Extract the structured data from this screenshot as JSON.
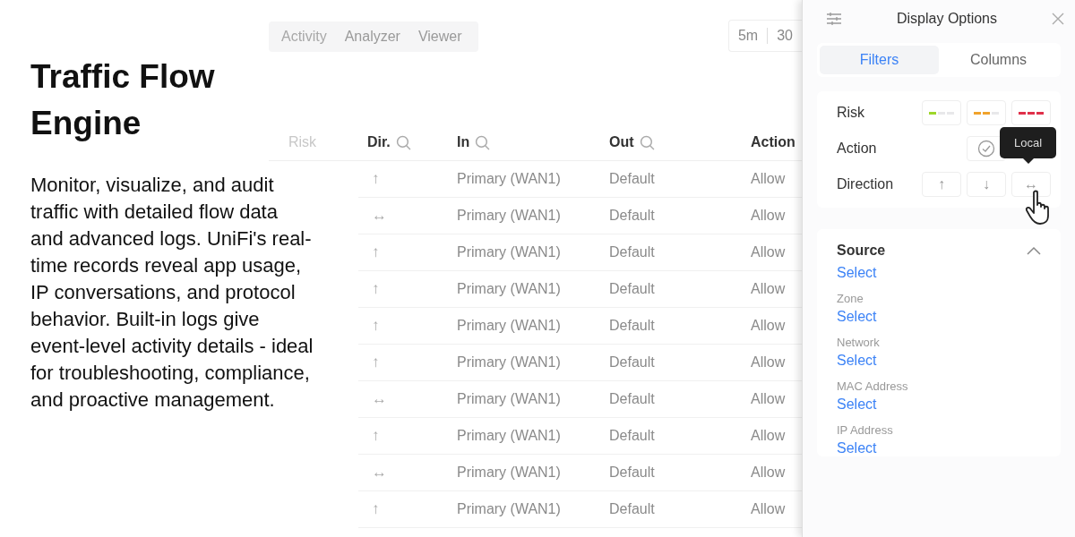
{
  "headline": "Traffic Flow Engine",
  "description": "Monitor, visualize, and audit traffic with detailed flow data and advanced logs. UniFi's real-time records reveal app usage, IP conversations, and protocol behavior. Built-in logs give event-level activity details - ideal for troubleshooting, compliance, and proactive management.",
  "toolbar": {
    "view_tabs": [
      "Activity",
      "Analyzer",
      "Viewer"
    ],
    "time_ranges": [
      "5m",
      "30"
    ]
  },
  "table": {
    "columns": [
      {
        "label": "Risk",
        "searchable": false
      },
      {
        "label": "Dir.",
        "searchable": true
      },
      {
        "label": "In",
        "searchable": true
      },
      {
        "label": "Out",
        "searchable": true
      },
      {
        "label": "Action",
        "searchable": false
      }
    ],
    "rows": [
      {
        "dir": "↑",
        "in": "Primary (WAN1)",
        "out": "Default",
        "action": "Allow"
      },
      {
        "dir": "↔",
        "in": "Primary (WAN1)",
        "out": "Default",
        "action": "Allow"
      },
      {
        "dir": "↑",
        "in": "Primary (WAN1)",
        "out": "Default",
        "action": "Allow"
      },
      {
        "dir": "↑",
        "in": "Primary (WAN1)",
        "out": "Default",
        "action": "Allow"
      },
      {
        "dir": "↑",
        "in": "Primary (WAN1)",
        "out": "Default",
        "action": "Allow"
      },
      {
        "dir": "↑",
        "in": "Primary (WAN1)",
        "out": "Default",
        "action": "Allow"
      },
      {
        "dir": "↔",
        "in": "Primary (WAN1)",
        "out": "Default",
        "action": "Allow"
      },
      {
        "dir": "↑",
        "in": "Primary (WAN1)",
        "out": "Default",
        "action": "Allow"
      },
      {
        "dir": "↔",
        "in": "Primary (WAN1)",
        "out": "Default",
        "action": "Allow"
      },
      {
        "dir": "↑",
        "in": "Primary (WAN1)",
        "out": "Default",
        "action": "Allow"
      }
    ]
  },
  "panel": {
    "title": "Display Options",
    "tabs": [
      {
        "label": "Filters",
        "selected": true
      },
      {
        "label": "Columns",
        "selected": false
      }
    ],
    "filters": [
      {
        "kind": "risk",
        "label": "Risk",
        "options": [
          {
            "color": "#9dd62a",
            "level": 0.33
          },
          {
            "color": "#f0a32c",
            "level": 0.67
          },
          {
            "color": "#e0304a",
            "level": 1
          }
        ]
      },
      {
        "kind": "action",
        "label": "Action"
      },
      {
        "kind": "direction",
        "label": "Direction",
        "options": [
          "↑",
          "↓",
          "↔"
        ]
      }
    ],
    "tooltip": "Local",
    "source": {
      "title": "Source",
      "expanded": true,
      "fields": [
        {
          "value": "Select"
        },
        {
          "label": "Zone",
          "value": "Select"
        },
        {
          "label": "Network",
          "value": "Select"
        },
        {
          "label": "MAC Address",
          "value": "Select"
        },
        {
          "label": "IP Address",
          "value": "Select"
        }
      ]
    }
  }
}
